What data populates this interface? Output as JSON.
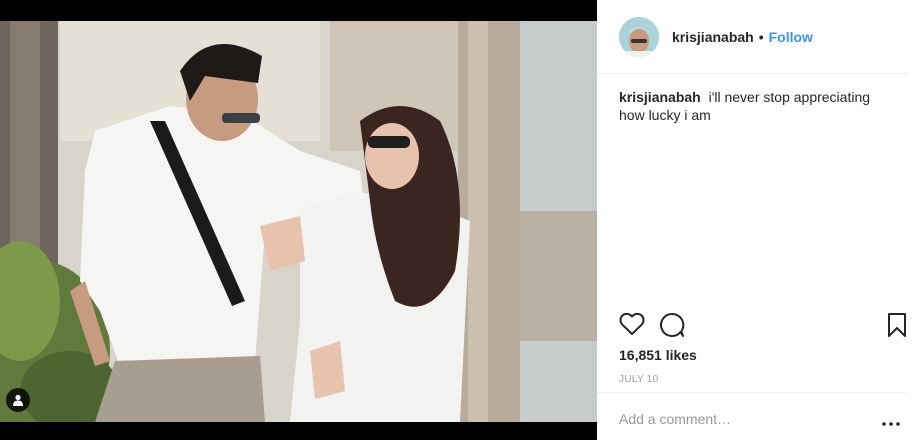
{
  "post": {
    "username": "krisjianabah",
    "follow_label": "Follow",
    "separator": "•",
    "caption_text": "i'll never stop appreciating how lucky i am",
    "likes": "16,851 likes",
    "date": "JULY 10"
  },
  "comment": {
    "placeholder": "Add a comment…"
  },
  "icons": {
    "like": "heart-icon",
    "comment": "comment-icon",
    "save": "bookmark-icon",
    "more": "more-options-icon",
    "tagged": "user-tag-icon"
  },
  "colors": {
    "follow": "#3897f0",
    "text": "#262626",
    "muted": "#999999",
    "divider": "#efefef"
  }
}
